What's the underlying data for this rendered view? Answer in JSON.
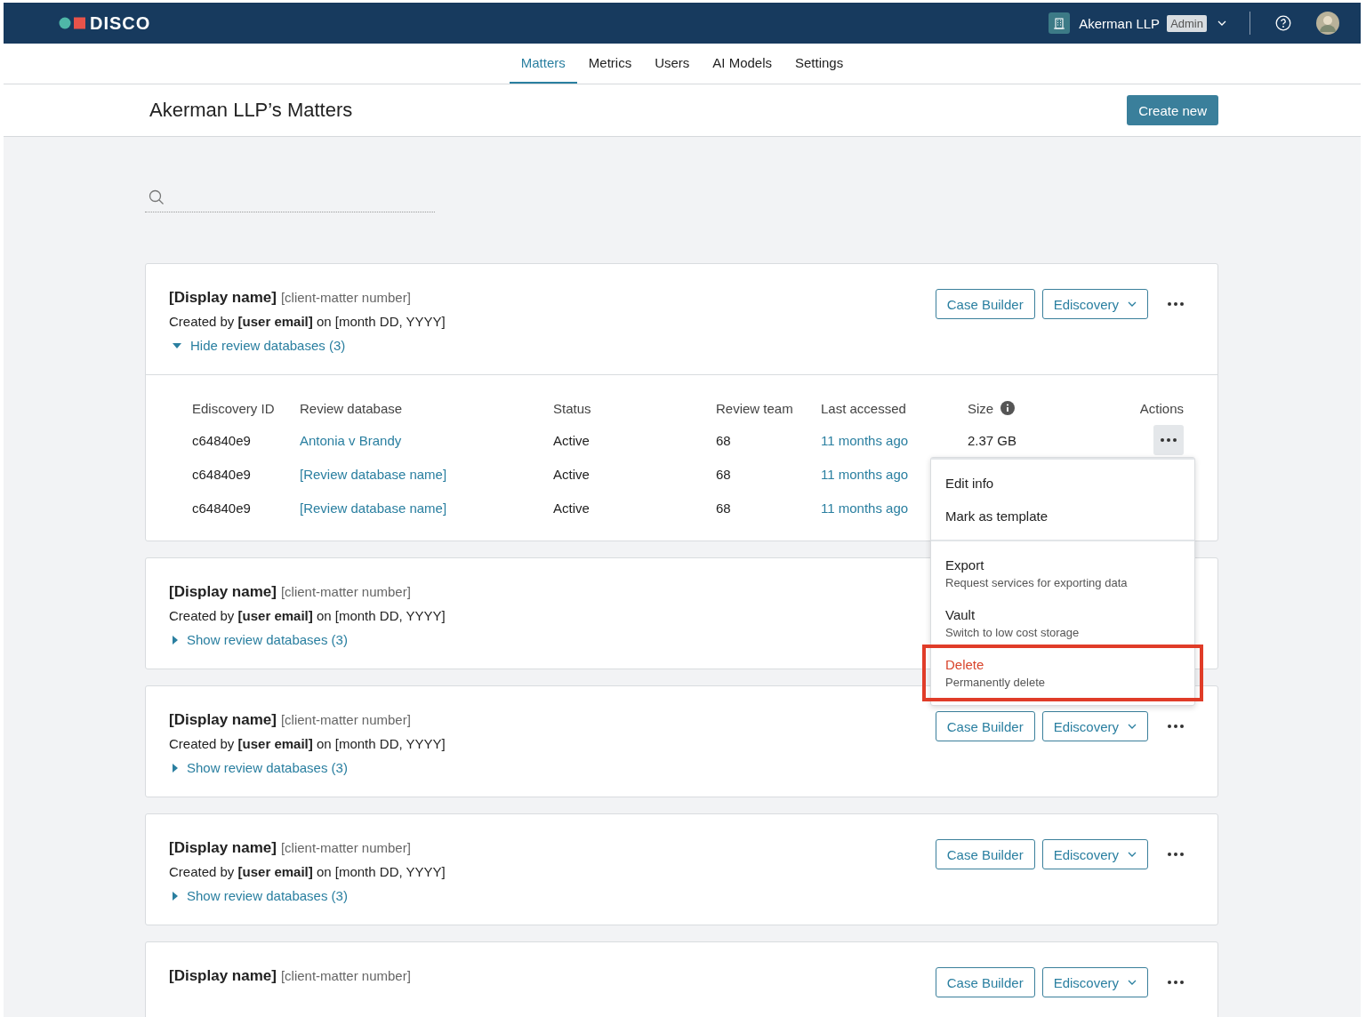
{
  "header": {
    "logo": "DISCO",
    "org": "Akerman LLP",
    "role_badge": "Admin"
  },
  "tabs": [
    {
      "label": "Matters",
      "selected": true
    },
    {
      "label": "Metrics",
      "selected": false
    },
    {
      "label": "Users",
      "selected": false
    },
    {
      "label": "AI Models",
      "selected": false
    },
    {
      "label": "Settings",
      "selected": false
    }
  ],
  "page": {
    "title": "Akerman LLP’s Matters",
    "create_button": "Create new"
  },
  "matters": [
    {
      "name": "[Display name]",
      "number": "[client-matter number]",
      "created": "Created by **[user email]** on [month DD, YYYY]",
      "toggle": "Hide review databases (3)",
      "expanded": true,
      "buttons": [
        "Case Builder",
        "Ediscovery"
      ],
      "table": {
        "columns": [
          "Ediscovery ID",
          "Review database",
          "Status",
          "Review team",
          "Last accessed",
          "Size",
          "Actions"
        ],
        "rows": [
          {
            "id": "c64840e9",
            "database": "Antonia v Brandy",
            "status": "Active",
            "team": "68",
            "last_accessed": "11 months ago",
            "size": "2.37 GB",
            "menu_open": true
          },
          {
            "id": "c64840e9",
            "database": "[Review database name]",
            "status": "Active",
            "team": "68",
            "last_accessed": "11 months ago"
          },
          {
            "id": "c64840e9",
            "database": "[Review database name]",
            "status": "Active",
            "team": "68",
            "last_accessed": "11 months ago"
          }
        ]
      }
    },
    {
      "name": "[Display name]",
      "number": "[client-matter number]",
      "created": "Created by **[user email]** on [month DD, YYYY]",
      "toggle": "Show review databases (3)",
      "expanded": false
    },
    {
      "name": "[Display name]",
      "number": "[client-matter number]",
      "created": "Created by **[user email]** on [month DD, YYYY]",
      "toggle": "Show review databases (3)",
      "expanded": false,
      "buttons": [
        "Case Builder",
        "Ediscovery"
      ]
    },
    {
      "name": "[Display name]",
      "number": "[client-matter number]",
      "created": "Created by **[user email]** on [month DD, YYYY]",
      "toggle": "Show review databases (3)",
      "expanded": false,
      "buttons": [
        "Case Builder",
        "Ediscovery"
      ]
    },
    {
      "name": "[Display name]",
      "number": "[client-matter number]",
      "buttons": [
        "Case Builder",
        "Ediscovery"
      ]
    }
  ],
  "action_menu": {
    "sections": [
      [
        {
          "label": "Edit info",
          "kind": "plain",
          "highlighted": false
        },
        {
          "label": "Mark as template",
          "kind": "plain",
          "highlighted": false
        }
      ],
      [
        {
          "label": "Export",
          "description": "Request services for exporting data",
          "kind": "plain",
          "highlighted": false
        },
        {
          "label": "Vault",
          "description": "Switch to low cost storage",
          "kind": "plain",
          "highlighted": false
        },
        {
          "label": "Delete",
          "description": "Permanently delete",
          "kind": "danger",
          "highlighted": true
        }
      ]
    ]
  }
}
